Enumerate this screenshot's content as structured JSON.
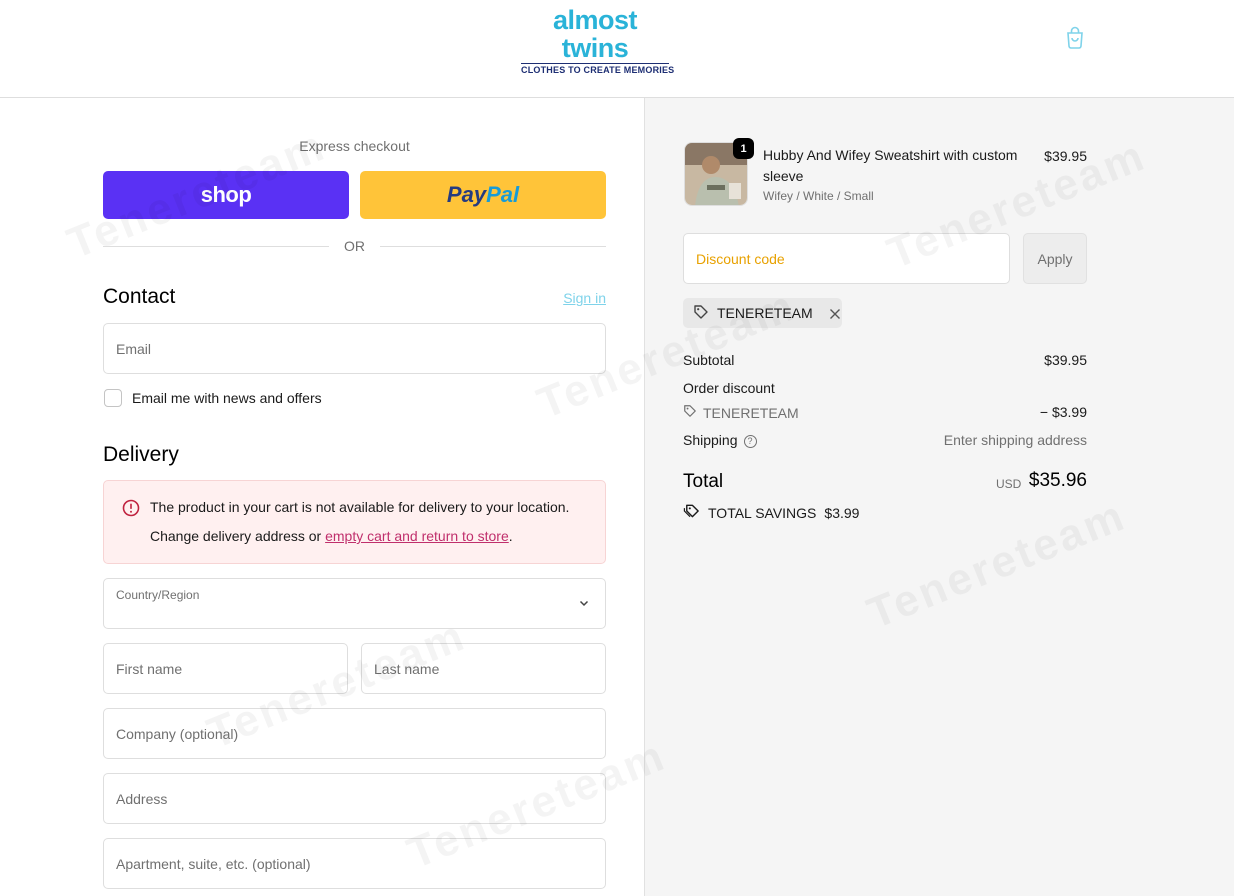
{
  "header": {
    "logo_main": "almost twins",
    "logo_tagline": "CLOTHES TO CREATE MEMORIES"
  },
  "watermark": {
    "text": "Tenereteam"
  },
  "express": {
    "label": "Express checkout",
    "shop_label": "shop",
    "paypal_a": "Pay",
    "paypal_b": "Pal",
    "or_label": "OR"
  },
  "contact": {
    "title": "Contact",
    "sign_in": "Sign in",
    "email_placeholder": "Email",
    "newsletter_label": "Email me with news and offers"
  },
  "delivery": {
    "title": "Delivery",
    "alert_line1": "The product in your cart is not available for delivery to your location.",
    "alert_line2_prefix": "Change delivery address or ",
    "alert_link": "empty cart and return to store",
    "alert_line2_suffix": ".",
    "country_label": "Country/Region",
    "first_name": "First name",
    "last_name": "Last name",
    "company": "Company (optional)",
    "address": "Address",
    "apartment": "Apartment, suite, etc. (optional)"
  },
  "order": {
    "item": {
      "quantity": "1",
      "name": "Hubby And Wifey Sweatshirt with custom sleeve",
      "variant": "Wifey / White / Small",
      "price": "$39.95"
    },
    "discount_placeholder": "Discount code",
    "apply_label": "Apply",
    "applied_code": "TENERETEAM",
    "subtotal_label": "Subtotal",
    "subtotal_value": "$39.95",
    "order_discount_label": "Order discount",
    "discount_code": "TENERETEAM",
    "discount_value": "− $3.99",
    "shipping_label": "Shipping",
    "shipping_value": "Enter shipping address",
    "total_label": "Total",
    "currency": "USD",
    "total_value": "$35.96",
    "savings_label": "TOTAL SAVINGS",
    "savings_value": "$3.99"
  },
  "colors": {
    "shop_purple": "#5a31f4",
    "paypal_yellow": "#ffc439",
    "link_cyan": "#7fd3ea",
    "alert_bg": "#fff0f0",
    "alert_red": "#c02f6c",
    "discount_placeholder": "#e8a100"
  }
}
